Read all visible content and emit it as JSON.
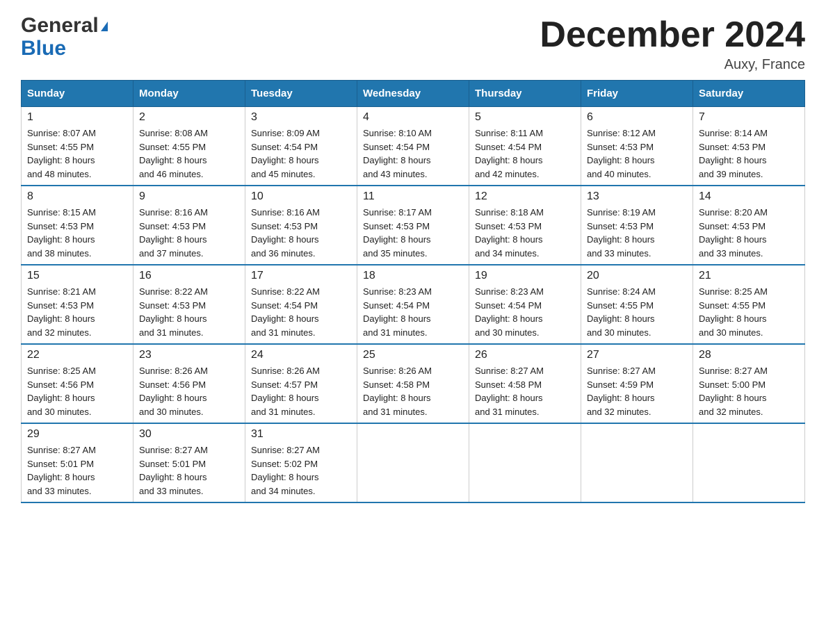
{
  "header": {
    "logo_general": "General",
    "logo_blue": "Blue",
    "month_title": "December 2024",
    "location": "Auxy, France"
  },
  "columns": [
    "Sunday",
    "Monday",
    "Tuesday",
    "Wednesday",
    "Thursday",
    "Friday",
    "Saturday"
  ],
  "weeks": [
    [
      {
        "day": "1",
        "sunrise": "8:07 AM",
        "sunset": "4:55 PM",
        "daylight": "8 hours and 48 minutes."
      },
      {
        "day": "2",
        "sunrise": "8:08 AM",
        "sunset": "4:55 PM",
        "daylight": "8 hours and 46 minutes."
      },
      {
        "day": "3",
        "sunrise": "8:09 AM",
        "sunset": "4:54 PM",
        "daylight": "8 hours and 45 minutes."
      },
      {
        "day": "4",
        "sunrise": "8:10 AM",
        "sunset": "4:54 PM",
        "daylight": "8 hours and 43 minutes."
      },
      {
        "day": "5",
        "sunrise": "8:11 AM",
        "sunset": "4:54 PM",
        "daylight": "8 hours and 42 minutes."
      },
      {
        "day": "6",
        "sunrise": "8:12 AM",
        "sunset": "4:53 PM",
        "daylight": "8 hours and 40 minutes."
      },
      {
        "day": "7",
        "sunrise": "8:14 AM",
        "sunset": "4:53 PM",
        "daylight": "8 hours and 39 minutes."
      }
    ],
    [
      {
        "day": "8",
        "sunrise": "8:15 AM",
        "sunset": "4:53 PM",
        "daylight": "8 hours and 38 minutes."
      },
      {
        "day": "9",
        "sunrise": "8:16 AM",
        "sunset": "4:53 PM",
        "daylight": "8 hours and 37 minutes."
      },
      {
        "day": "10",
        "sunrise": "8:16 AM",
        "sunset": "4:53 PM",
        "daylight": "8 hours and 36 minutes."
      },
      {
        "day": "11",
        "sunrise": "8:17 AM",
        "sunset": "4:53 PM",
        "daylight": "8 hours and 35 minutes."
      },
      {
        "day": "12",
        "sunrise": "8:18 AM",
        "sunset": "4:53 PM",
        "daylight": "8 hours and 34 minutes."
      },
      {
        "day": "13",
        "sunrise": "8:19 AM",
        "sunset": "4:53 PM",
        "daylight": "8 hours and 33 minutes."
      },
      {
        "day": "14",
        "sunrise": "8:20 AM",
        "sunset": "4:53 PM",
        "daylight": "8 hours and 33 minutes."
      }
    ],
    [
      {
        "day": "15",
        "sunrise": "8:21 AM",
        "sunset": "4:53 PM",
        "daylight": "8 hours and 32 minutes."
      },
      {
        "day": "16",
        "sunrise": "8:22 AM",
        "sunset": "4:53 PM",
        "daylight": "8 hours and 31 minutes."
      },
      {
        "day": "17",
        "sunrise": "8:22 AM",
        "sunset": "4:54 PM",
        "daylight": "8 hours and 31 minutes."
      },
      {
        "day": "18",
        "sunrise": "8:23 AM",
        "sunset": "4:54 PM",
        "daylight": "8 hours and 31 minutes."
      },
      {
        "day": "19",
        "sunrise": "8:23 AM",
        "sunset": "4:54 PM",
        "daylight": "8 hours and 30 minutes."
      },
      {
        "day": "20",
        "sunrise": "8:24 AM",
        "sunset": "4:55 PM",
        "daylight": "8 hours and 30 minutes."
      },
      {
        "day": "21",
        "sunrise": "8:25 AM",
        "sunset": "4:55 PM",
        "daylight": "8 hours and 30 minutes."
      }
    ],
    [
      {
        "day": "22",
        "sunrise": "8:25 AM",
        "sunset": "4:56 PM",
        "daylight": "8 hours and 30 minutes."
      },
      {
        "day": "23",
        "sunrise": "8:26 AM",
        "sunset": "4:56 PM",
        "daylight": "8 hours and 30 minutes."
      },
      {
        "day": "24",
        "sunrise": "8:26 AM",
        "sunset": "4:57 PM",
        "daylight": "8 hours and 31 minutes."
      },
      {
        "day": "25",
        "sunrise": "8:26 AM",
        "sunset": "4:58 PM",
        "daylight": "8 hours and 31 minutes."
      },
      {
        "day": "26",
        "sunrise": "8:27 AM",
        "sunset": "4:58 PM",
        "daylight": "8 hours and 31 minutes."
      },
      {
        "day": "27",
        "sunrise": "8:27 AM",
        "sunset": "4:59 PM",
        "daylight": "8 hours and 32 minutes."
      },
      {
        "day": "28",
        "sunrise": "8:27 AM",
        "sunset": "5:00 PM",
        "daylight": "8 hours and 32 minutes."
      }
    ],
    [
      {
        "day": "29",
        "sunrise": "8:27 AM",
        "sunset": "5:01 PM",
        "daylight": "8 hours and 33 minutes."
      },
      {
        "day": "30",
        "sunrise": "8:27 AM",
        "sunset": "5:01 PM",
        "daylight": "8 hours and 33 minutes."
      },
      {
        "day": "31",
        "sunrise": "8:27 AM",
        "sunset": "5:02 PM",
        "daylight": "8 hours and 34 minutes."
      },
      null,
      null,
      null,
      null
    ]
  ]
}
